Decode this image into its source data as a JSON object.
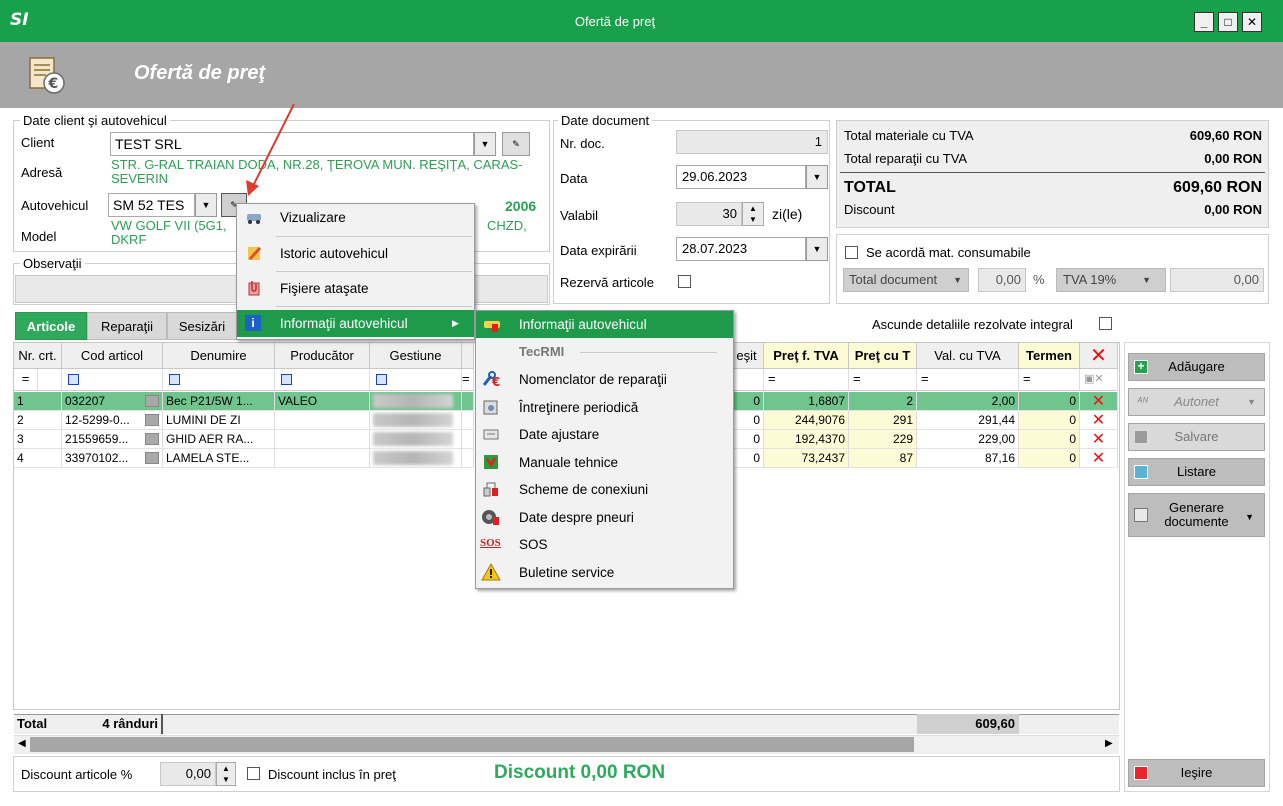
{
  "window": {
    "title": "Ofertă de preţ",
    "logo": "SI",
    "min": "_",
    "max": "□",
    "close": "✕"
  },
  "banner": {
    "title": "Ofertă de preţ"
  },
  "client_section": {
    "legend": "Date client şi autovehicul",
    "client_label": "Client",
    "client_value": "TEST SRL",
    "address_label": "Adresă",
    "address_value": "STR. G-RAL TRAIAN DODA, NR.28, ŢEROVA MUN. REŞIŢA, CARAS-SEVERIN",
    "vehicle_label": "Autovehicul",
    "vehicle_value": "SM 52 TES",
    "vehicle_year": "2006",
    "model_label": "Model",
    "model_value": "VW GOLF VII (5G1, ",
    "model_value2": "CHZD, DKRF"
  },
  "observatii": {
    "legend": "Observaţii"
  },
  "doc_section": {
    "legend": "Date document",
    "nr_label": "Nr. doc.",
    "nr_value": "1",
    "data_label": "Data",
    "data_value": "29.06.2023",
    "valabil_label": "Valabil",
    "valabil_value": "30",
    "valabil_unit": "zi(le)",
    "exp_label": "Data expirării",
    "exp_value": "28.07.2023",
    "rezerva_label": "Rezervă articole"
  },
  "totals": {
    "mat_label": "Total materiale cu TVA",
    "mat_value": "609,60 RON",
    "rep_label": "Total reparaţii cu TVA",
    "rep_value": "0,00 RON",
    "total_label": "TOTAL",
    "total_value": "609,60 RON",
    "discount_label": "Discount",
    "discount_value": "0,00 RON"
  },
  "consumables": {
    "check_label": "Se acordă mat. consumabile",
    "base": "Total document",
    "pct": "0,00",
    "pct_sign": "%",
    "tva": "TVA 19%",
    "amount": "0,00"
  },
  "tabs": [
    "Articole",
    "Reparaţii",
    "Sesizări"
  ],
  "hide_resolved": "Ascunde detaliile rezolvate integral",
  "table": {
    "headers": [
      "Nr. crt.",
      "Cod articol",
      "Denumire",
      "Producător",
      "Gestiune"
    ],
    "headers_right": [
      "eşit",
      "Preţ f. TVA",
      "Preţ cu T",
      "Val. cu TVA",
      "Termen"
    ],
    "filter_eq": "=",
    "rows": [
      {
        "nr": "1",
        "cod": "032207",
        "den": "Bec P21/5W 1...",
        "prod": "VALEO",
        "esit": "0",
        "pf": "1,6807",
        "pc": "2",
        "val": "2,00",
        "term": "0"
      },
      {
        "nr": "2",
        "cod": "12-5299-0...",
        "den": "LUMINI DE ZI",
        "prod": "",
        "esit": "0",
        "pf": "244,9076",
        "pc": "291",
        "val": "291,44",
        "term": "0"
      },
      {
        "nr": "3",
        "cod": "21559659...",
        "den": "GHID AER RA...",
        "prod": "",
        "esit": "0",
        "pf": "192,4370",
        "pc": "229",
        "val": "229,00",
        "term": "0"
      },
      {
        "nr": "4",
        "cod": "33970102...",
        "den": "LAMELA STE...",
        "prod": "",
        "esit": "0",
        "pf": "73,2437",
        "pc": "87",
        "val": "87,16",
        "term": "0"
      }
    ],
    "total_label": "Total",
    "total_rows": "4 rânduri",
    "total_value": "609,60"
  },
  "side_buttons": {
    "add": "Adăugare",
    "autonet": "Autonet",
    "save": "Salvare",
    "print": "Listare",
    "gen": "Generare documente",
    "exit": "Ieşire"
  },
  "bottom": {
    "disc_label": "Discount articole %",
    "disc_value": "0,00",
    "incl_label": "Discount inclus în preţ",
    "disc_big": "Discount  0,00 RON"
  },
  "context_menu": {
    "items": [
      "Vizualizare",
      "Istoric autovehicul",
      "Fişiere ataşate",
      "Informaţii autovehicul"
    ],
    "arrow": "▶"
  },
  "submenu": {
    "items": [
      "Informaţii autovehicul",
      "Nomenclator de reparaţii",
      "Întreţinere periodică",
      "Date ajustare",
      "Manuale tehnice",
      "Scheme de conexiuni",
      "Date despre pneuri",
      "SOS",
      "Buletine service"
    ],
    "section": "TecRMI",
    "sos": "SOS"
  },
  "colors": {
    "accent": "#19a04b",
    "banner": "#a6a6a6",
    "green_text": "#2e9e55",
    "selected_row": "#6fc58d",
    "delete": "#e11111"
  }
}
